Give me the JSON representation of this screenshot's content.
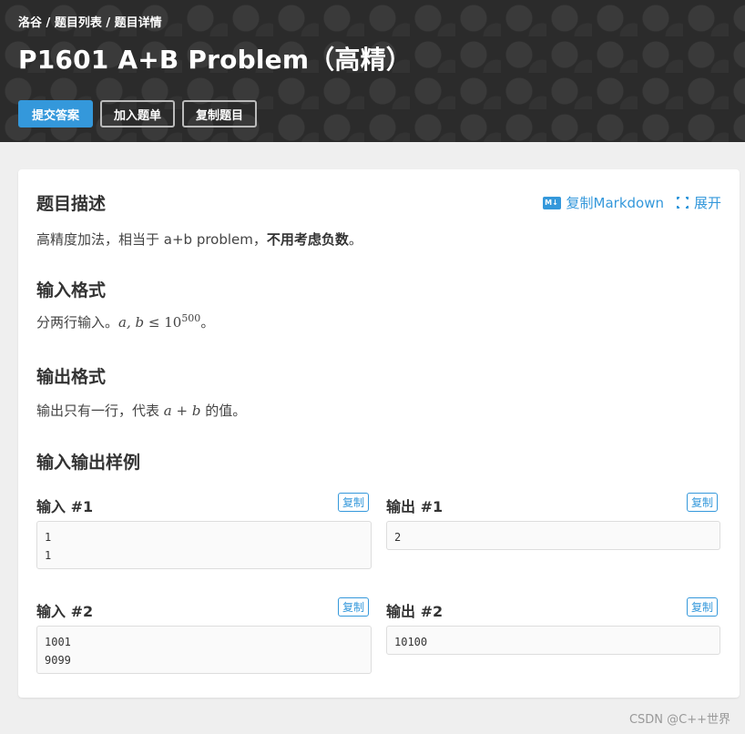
{
  "breadcrumb": {
    "home": "洛谷",
    "sep1": " / ",
    "list": "题目列表",
    "sep2": " / ",
    "detail": "题目详情"
  },
  "problem": {
    "title": "P1601 A+B Problem（高精）"
  },
  "actions": {
    "submit": "提交答案",
    "add_list": "加入题单",
    "copy_problem": "复制题目"
  },
  "links": {
    "copy_markdown": "复制Markdown",
    "expand": "展开"
  },
  "description": {
    "heading": "题目描述",
    "text_pre": "高精度加法，相当于 a+b problem，",
    "text_bold": "不用考虑负数",
    "text_post": "。"
  },
  "input_format": {
    "heading": "输入格式",
    "text_pre": "分两行输入。",
    "math_vars": "a, b",
    "math_le": " ≤ ",
    "math_base": "10",
    "math_exp": "500",
    "text_post": "。"
  },
  "output_format": {
    "heading": "输出格式",
    "text_pre": "输出只有一行，代表 ",
    "math_a": "a",
    "math_plus": " + ",
    "math_b": "b",
    "text_post": " 的值。"
  },
  "samples": {
    "heading": "输入输出样例",
    "copy_label": "复制",
    "items": [
      {
        "input_label": "输入 #1",
        "input_lines": [
          "1",
          "1"
        ],
        "output_label": "输出 #1",
        "output_lines": [
          "2"
        ]
      },
      {
        "input_label": "输入 #2",
        "input_lines": [
          "1001",
          "9099"
        ],
        "output_label": "输出 #2",
        "output_lines": [
          "10100"
        ]
      }
    ]
  },
  "watermark": "CSDN @C++世界",
  "colors": {
    "accent": "#3498db",
    "header_bg": "#2b2b2b",
    "page_bg": "#efefef"
  },
  "icons": {
    "markdown": "markdown-icon",
    "expand": "expand-icon"
  },
  "icon_text": {
    "markdown": "M↓"
  }
}
